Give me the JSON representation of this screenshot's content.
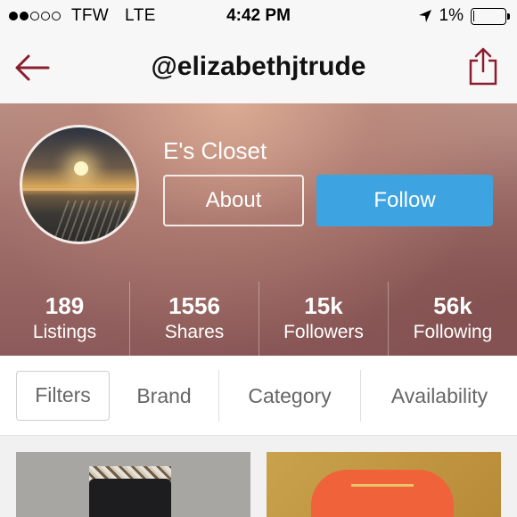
{
  "status_bar": {
    "carrier": "TFW",
    "network": "LTE",
    "time": "4:42 PM",
    "battery": "1%",
    "battery_level": 0.01,
    "signal_strength": 2,
    "icons": [
      "signal-icon",
      "location-arrow-icon",
      "battery-icon"
    ]
  },
  "nav": {
    "title": "@elizabethjtrude",
    "back_icon": "back-arrow-icon",
    "share_icon": "share-icon",
    "accent_color": "#8b1d2c"
  },
  "profile": {
    "closet_name": "E's Closet",
    "about_label": "About",
    "follow_label": "Follow",
    "follow_color": "#3da3e1",
    "stats": [
      {
        "value": "189",
        "label": "Listings"
      },
      {
        "value": "1556",
        "label": "Shares"
      },
      {
        "value": "15k",
        "label": "Followers"
      },
      {
        "value": "56k",
        "label": "Following"
      }
    ]
  },
  "filters": {
    "filters_label": "Filters",
    "brand_label": "Brand",
    "category_label": "Category",
    "availability_label": "Availability"
  }
}
